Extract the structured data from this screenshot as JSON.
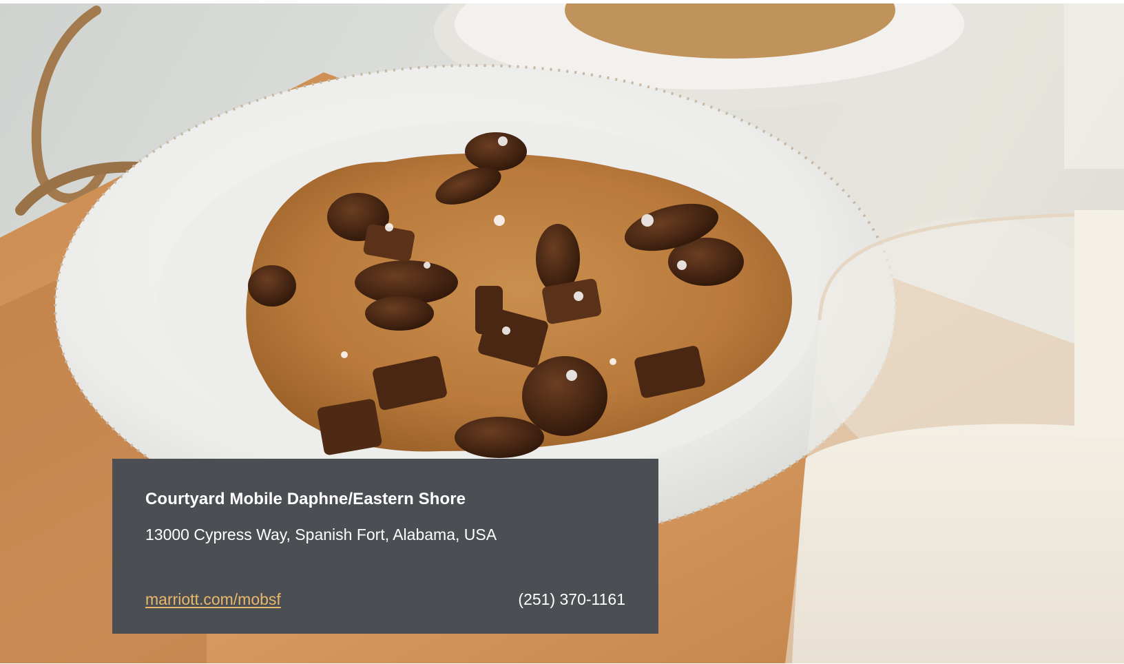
{
  "hero": {
    "image_subject": "cookie-on-plate-photo"
  },
  "card": {
    "hotel_name": "Courtyard Mobile Daphne/Eastern Shore",
    "address": "13000 Cypress Way, Spanish Fort, Alabama, USA",
    "website": "marriott.com/mobsf",
    "phone": "(251) 370-1161"
  },
  "colors": {
    "card_background": "#4b4f54",
    "link": "#e9b86c",
    "text": "#ffffff"
  }
}
